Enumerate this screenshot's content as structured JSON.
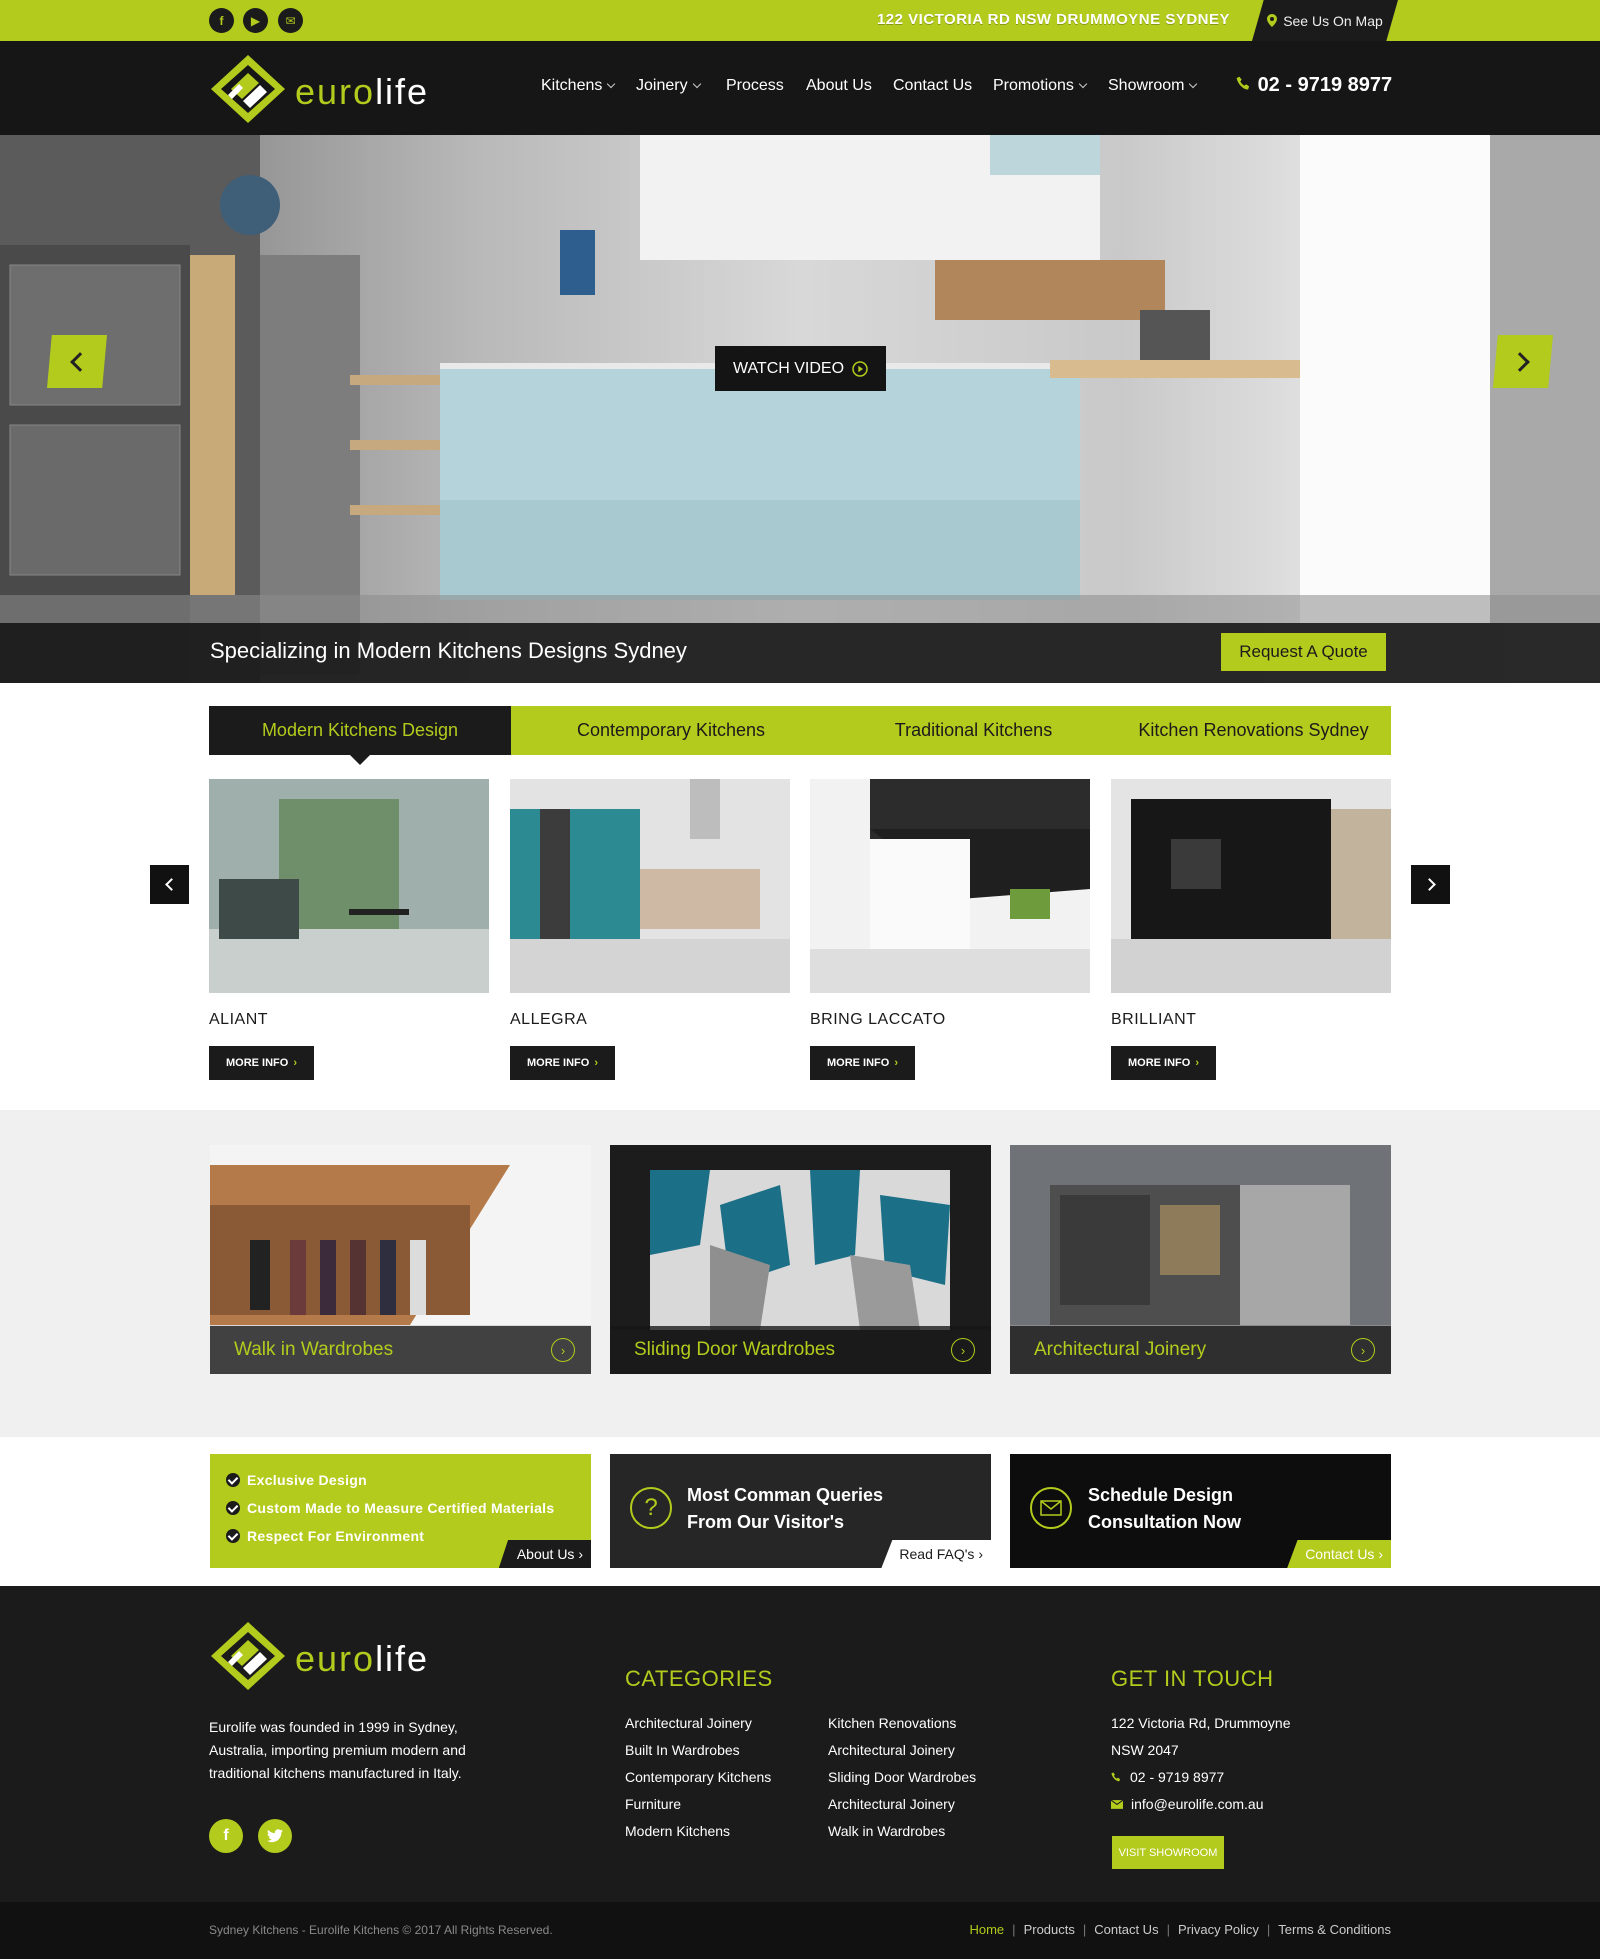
{
  "topbar": {
    "social": [
      {
        "icon": "facebook-icon",
        "glyph": "f"
      },
      {
        "icon": "youtube-icon",
        "glyph": "▶"
      },
      {
        "icon": "email-icon",
        "glyph": "✉"
      }
    ],
    "address": "122 VICTORIA RD NSW DRUMMOYNE SYDNEY",
    "map_link": "See Us On Map"
  },
  "header": {
    "logo": {
      "part1": "euro",
      "part2": "life"
    },
    "nav": [
      "Kitchens",
      "Joinery",
      "Process",
      "About Us",
      "Contact Us",
      "Promotions",
      "Showroom"
    ],
    "phone": "02 - 9719 8977"
  },
  "hero": {
    "watch_video": "WATCH VIDEO",
    "tagline": "Specializing in Modern Kitchens Designs Sydney",
    "quote_button": "Request A Quote"
  },
  "tabs": [
    "Modern Kitchens Design",
    "Contemporary Kitchens",
    "Traditional Kitchens",
    "Kitchen Renovations Sydney"
  ],
  "products": [
    {
      "name": "ALIANT",
      "more": "MORE INFO"
    },
    {
      "name": "ALLEGRA",
      "more": "MORE INFO"
    },
    {
      "name": "BRING LACCATO",
      "more": "MORE INFO"
    },
    {
      "name": "BRILLIANT",
      "more": "MORE INFO"
    }
  ],
  "wardrobes": [
    "Walk in Wardrobes",
    "Sliding Door Wardrobes",
    "Architectural Joinery"
  ],
  "promos": {
    "features": [
      "Exclusive Design",
      "Custom Made to Measure Certified Materials",
      "Respect For Environment"
    ],
    "about_link": "About Us",
    "faq_title_1": "Most Comman Queries",
    "faq_title_2": "From Our Visitor's",
    "faq_link": "Read FAQ's",
    "consult_title_1": "Schedule Design",
    "consult_title_2": "Consultation Now",
    "contact_link": "Contact Us"
  },
  "footer": {
    "about": "Eurolife was founded in 1999 in Sydney, Australia, importing premium modern and traditional kitchens manufactured in Italy.",
    "categories_heading": "CATEGORIES",
    "categories_col1": [
      "Architectural Joinery",
      "Built In Wardrobes",
      "Contemporary Kitchens",
      "Furniture",
      "Modern Kitchens"
    ],
    "categories_col2": [
      "Kitchen Renovations",
      "Architectural Joinery",
      "Sliding Door Wardrobes",
      "Architectural Joinery",
      "Walk in Wardrobes"
    ],
    "contact_heading": "GET IN TOUCH",
    "address_line1": "122 Victoria Rd, Drummoyne",
    "address_line2": "NSW 2047",
    "phone": "02 - 9719 8977",
    "email": "info@eurolife.com.au",
    "showroom_button": "VISIT SHOWROOM",
    "copyright": "Sydney Kitchens - Eurolife Kitchens © 2017 All Rights Reserved.",
    "bottom_links": [
      "Home",
      "Products",
      "Contact Us",
      "Privacy Policy",
      "Terms & Conditions"
    ]
  },
  "colors": {
    "accent": "#b3cb1c",
    "dark": "#1b1b1b"
  }
}
